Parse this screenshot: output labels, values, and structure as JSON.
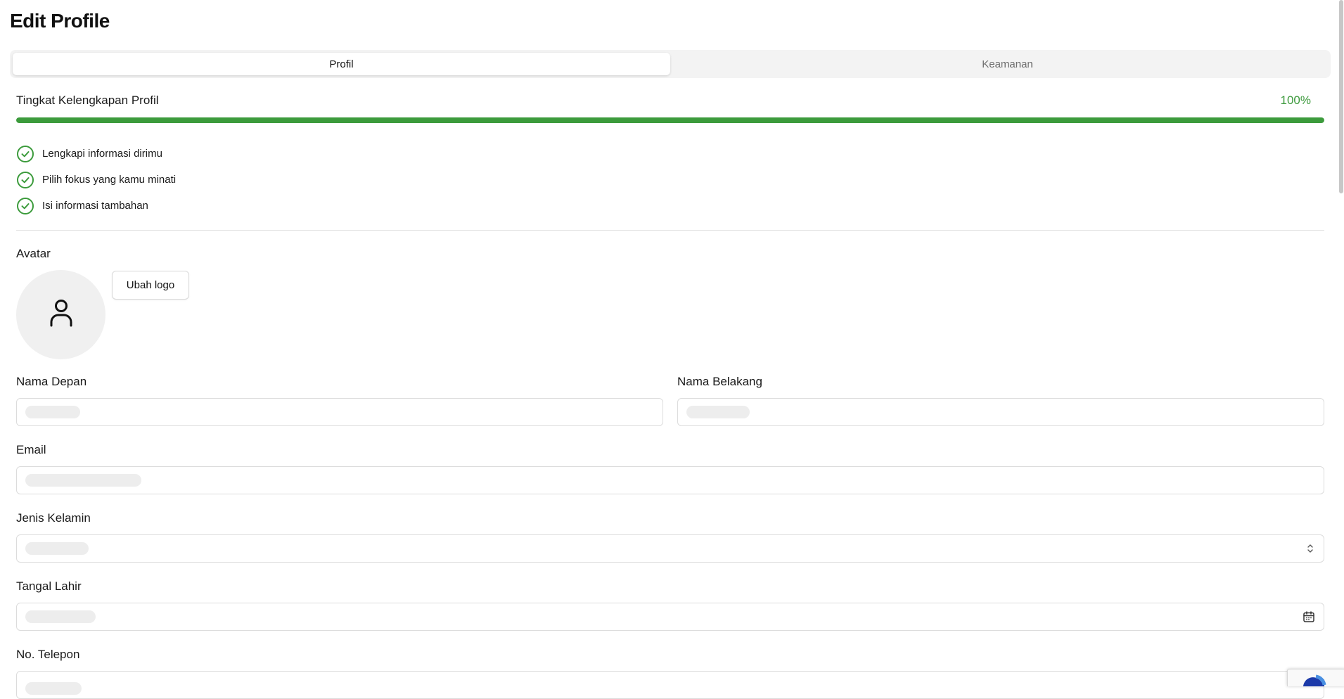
{
  "page": {
    "title": "Edit Profile"
  },
  "tabs": [
    {
      "label": "Profil",
      "active": true
    },
    {
      "label": "Keamanan",
      "active": false
    }
  ],
  "completeness": {
    "label": "Tingkat Kelengkapan Profil",
    "value_text": "100%",
    "fraction": 1.0,
    "color": "#3c9b3c"
  },
  "checklist": [
    {
      "label": "Lengkapi informasi dirimu",
      "done": true
    },
    {
      "label": "Pilih fokus yang kamu minati",
      "done": true
    },
    {
      "label": "Isi informasi tambahan",
      "done": true
    }
  ],
  "avatar": {
    "label": "Avatar",
    "placeholder_icon": "user-icon",
    "change_button_label": "Ubah logo"
  },
  "fields": {
    "first_name": {
      "label": "Nama Depan",
      "value": ""
    },
    "last_name": {
      "label": "Nama Belakang",
      "value": ""
    },
    "email": {
      "label": "Email",
      "value": ""
    },
    "gender": {
      "label": "Jenis Kelamin",
      "value": "",
      "icon": "chevron-up-down-icon"
    },
    "birth_date": {
      "label": "Tangal Lahir",
      "value": "",
      "icon": "calendar-icon"
    },
    "phone": {
      "label": "No. Telepon",
      "value": ""
    }
  },
  "colors": {
    "accent_green": "#3c9b3c",
    "tab_inactive_text": "#6b6b6b"
  }
}
